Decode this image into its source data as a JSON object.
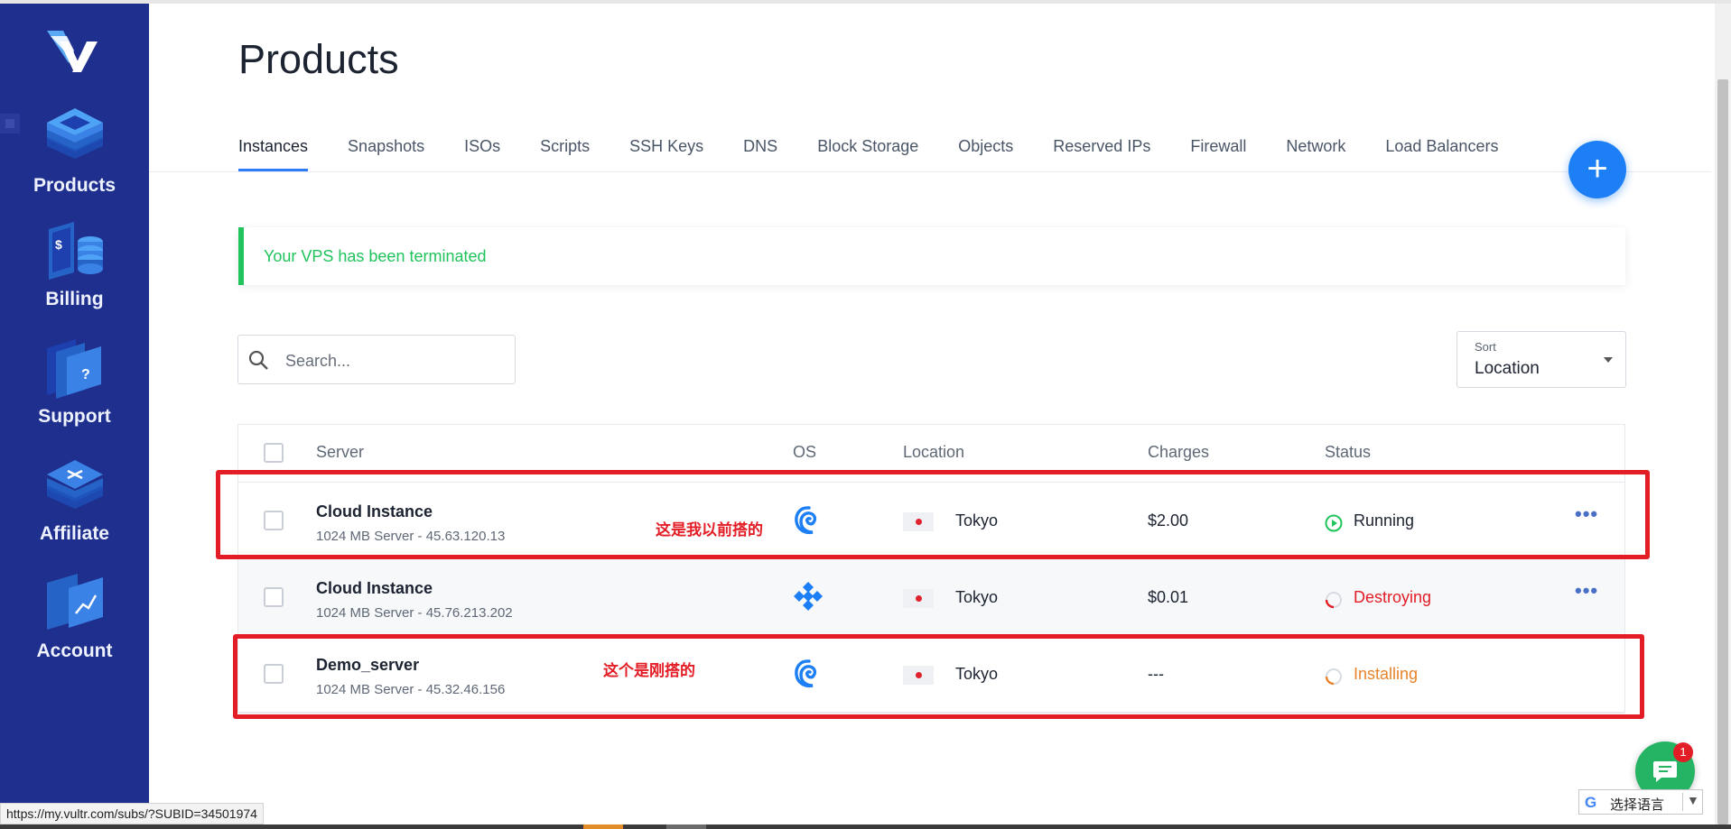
{
  "sidebar": {
    "items": [
      {
        "label": "Products",
        "icon": "products-layers-icon"
      },
      {
        "label": "Billing",
        "icon": "billing-icon"
      },
      {
        "label": "Support",
        "icon": "support-icon"
      },
      {
        "label": "Affiliate",
        "icon": "affiliate-icon"
      },
      {
        "label": "Account",
        "icon": "account-icon"
      }
    ]
  },
  "page": {
    "title": "Products",
    "tabs": [
      "Instances",
      "Snapshots",
      "ISOs",
      "Scripts",
      "SSH Keys",
      "DNS",
      "Block Storage",
      "Objects",
      "Reserved IPs",
      "Firewall",
      "Network",
      "Load Balancers"
    ],
    "active_tab": "Instances",
    "add_button": "+"
  },
  "alert": {
    "message": "Your VPS has been terminated"
  },
  "search": {
    "placeholder": "Search..."
  },
  "sort": {
    "label": "Sort",
    "value": "Location"
  },
  "table": {
    "headers": {
      "server": "Server",
      "os": "OS",
      "location": "Location",
      "charges": "Charges",
      "status": "Status"
    },
    "rows": [
      {
        "name": "Cloud Instance",
        "sub": "1024 MB Server - 45.63.120.13",
        "os": "debian-icon",
        "location": "Tokyo",
        "charges": "$2.00",
        "status": "Running",
        "more": "•••"
      },
      {
        "name": "Cloud Instance",
        "sub": "1024 MB Server - 45.76.213.202",
        "os": "vultr-diamond-icon",
        "location": "Tokyo",
        "charges": "$0.01",
        "status": "Destroying",
        "more": "•••"
      },
      {
        "name": "Demo_server",
        "sub": "1024 MB Server - 45.32.46.156",
        "os": "debian-icon",
        "location": "Tokyo",
        "charges": "---",
        "status": "Installing"
      }
    ]
  },
  "annotations": [
    "这是我以前搭的",
    "这个是刚搭的"
  ],
  "chat": {
    "badge": "1"
  },
  "translate": {
    "g": "G",
    "label": "选择语言",
    "caret": "▼"
  },
  "statusbar": {
    "url": "https://my.vultr.com/subs/?SUBID=34501974"
  },
  "colors": {
    "sidebar": "#1e2f8d",
    "accent": "#1d7ff5",
    "success": "#21c35c",
    "running": "#21c35c",
    "destroying": "#e31d25",
    "installing": "#e8832a",
    "annotation": "#e31d25"
  }
}
